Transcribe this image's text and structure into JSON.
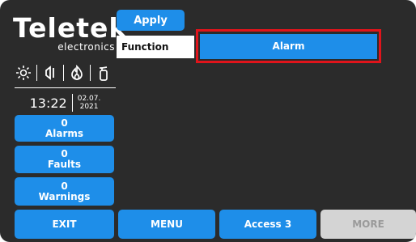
{
  "brand": {
    "name": "Teletek",
    "sub": "electronics"
  },
  "toolbar": {
    "apply_label": "Apply"
  },
  "function": {
    "label": "Function",
    "value": "Alarm"
  },
  "status_icons": [
    "sun-icon",
    "speaker-icon",
    "fire-icon",
    "extinguisher-icon"
  ],
  "clock": {
    "time": "13:22",
    "date_line1": "02.07.",
    "date_line2": "2021"
  },
  "counters": [
    {
      "count": "0",
      "label": "Alarms"
    },
    {
      "count": "0",
      "label": "Faults"
    },
    {
      "count": "0",
      "label": "Warnings"
    }
  ],
  "bottom": {
    "exit": "EXIT",
    "menu": "MENU",
    "access": "Access 3",
    "more": "MORE"
  },
  "colors": {
    "background": "#2b2b2b",
    "button": "#1e8ee9",
    "highlight": "#e0141b",
    "disabled": "#d4d4d4"
  }
}
